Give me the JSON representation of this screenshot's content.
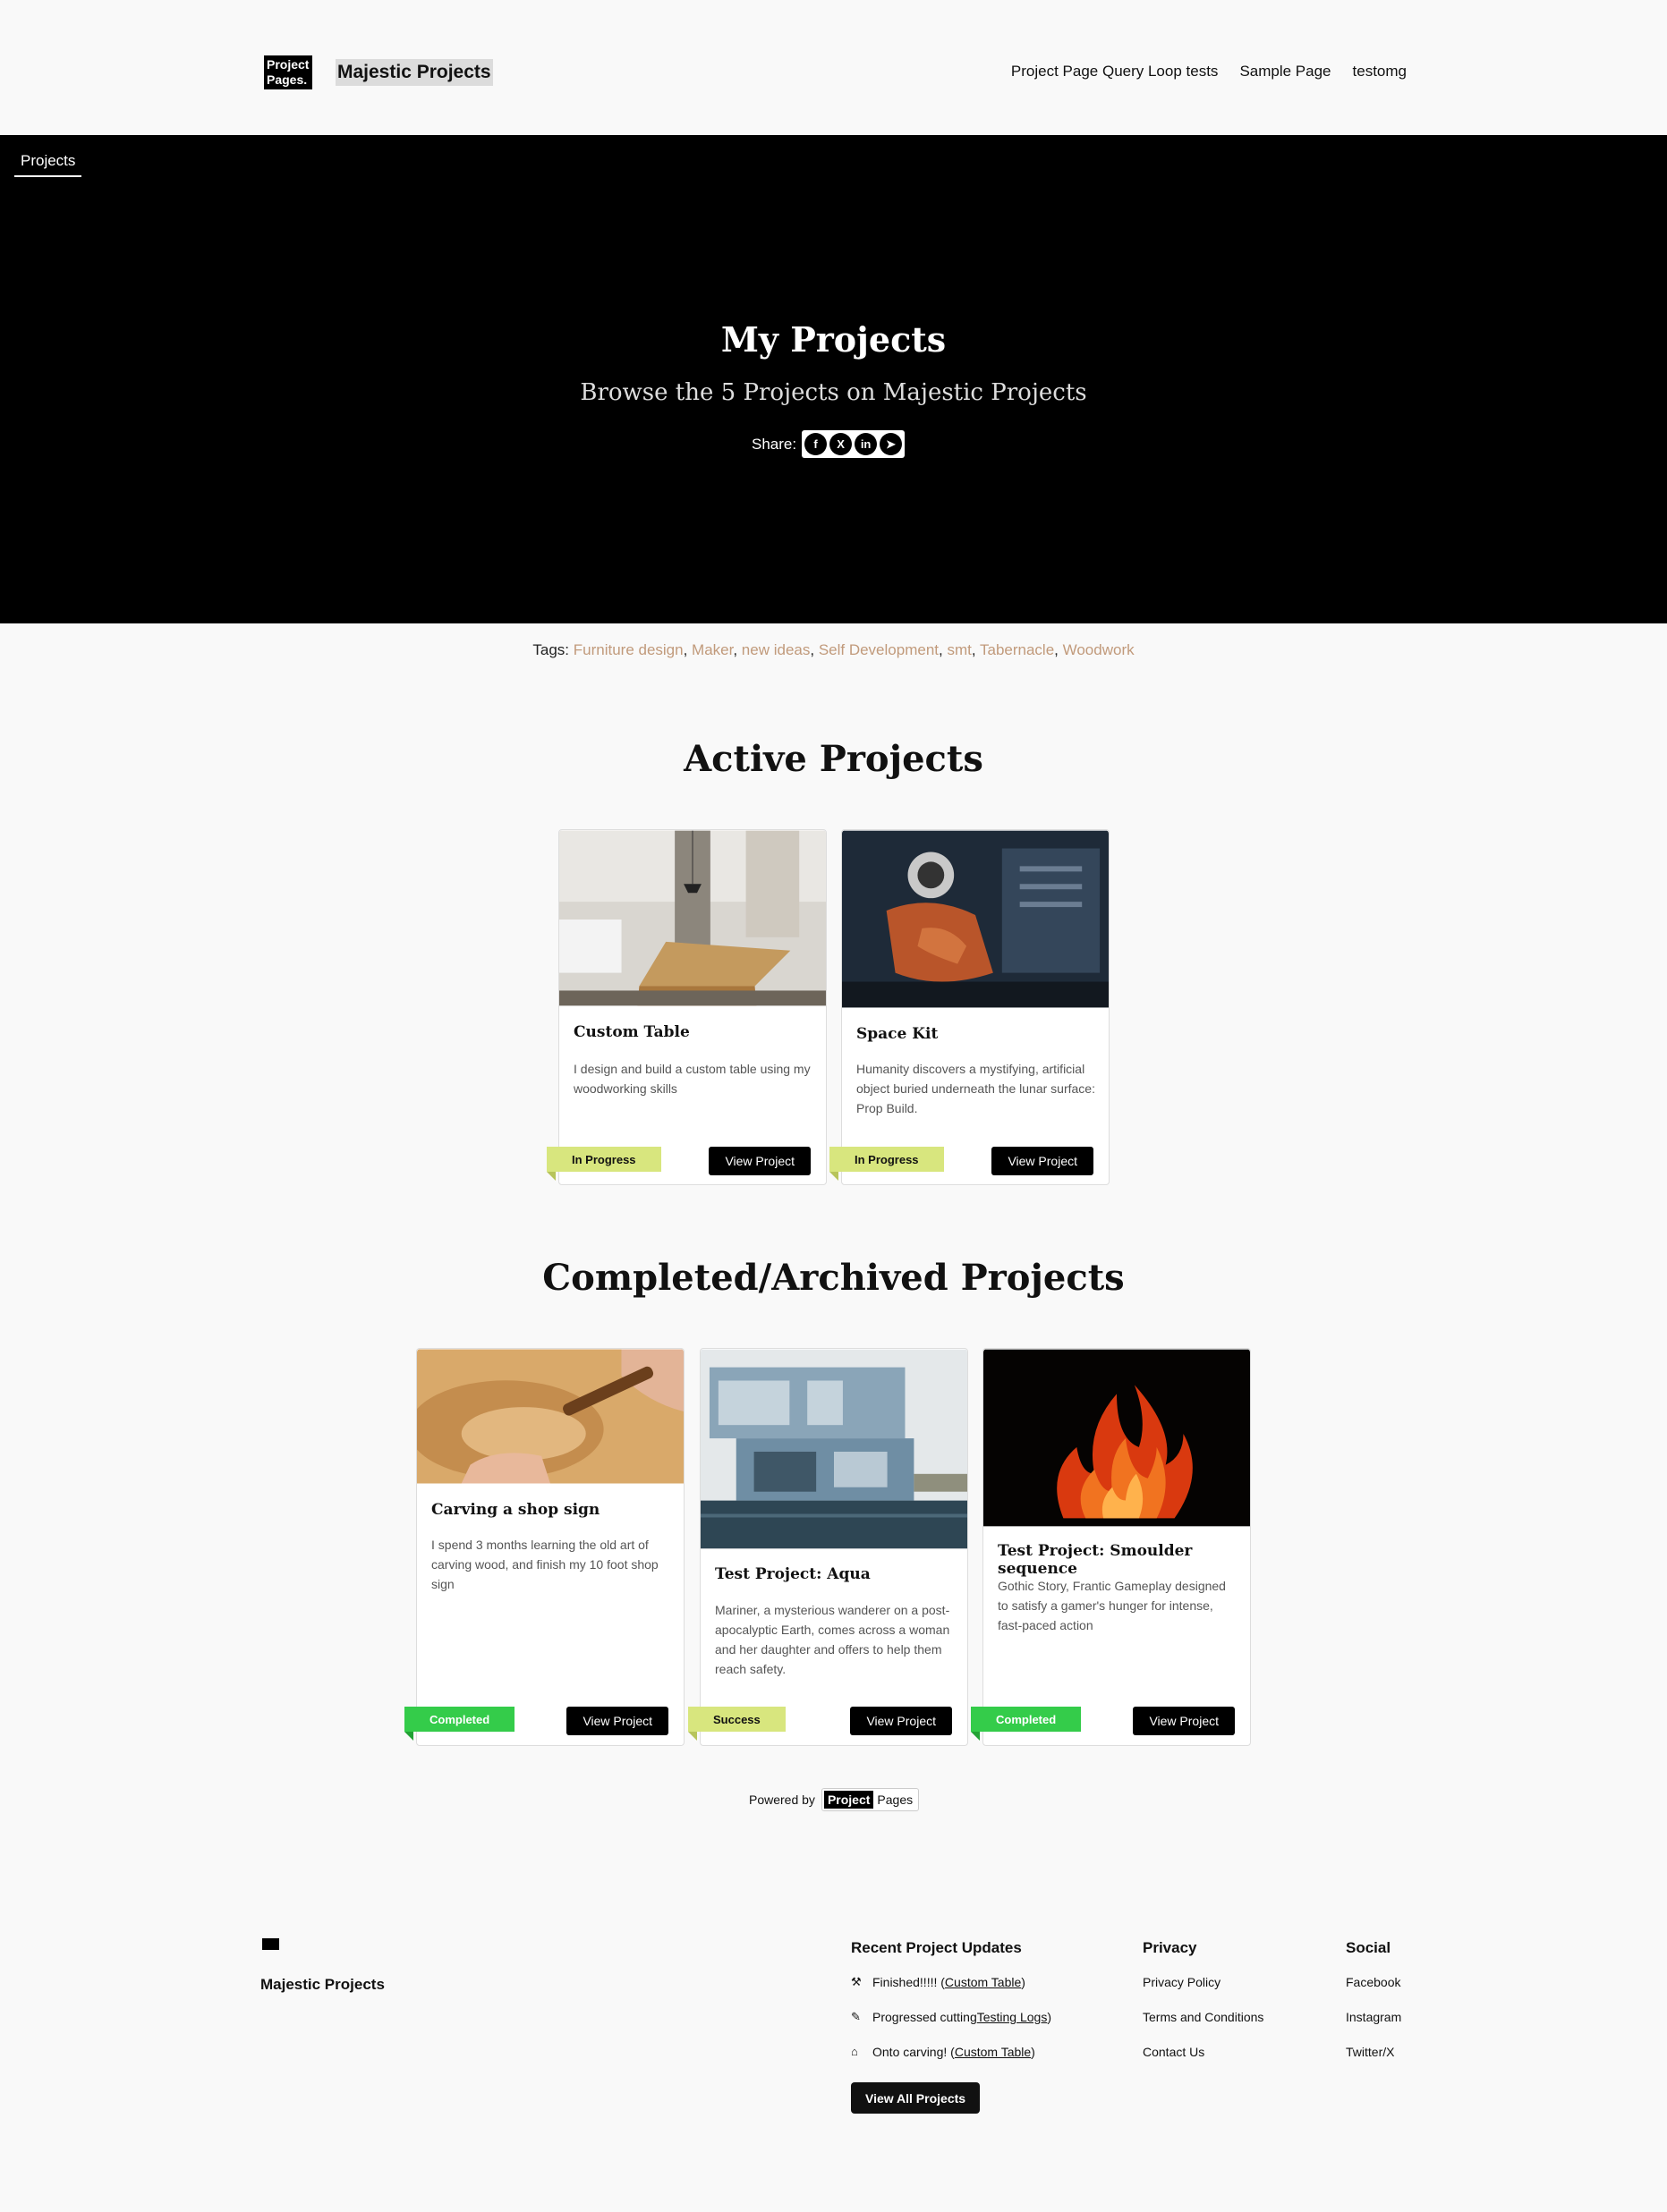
{
  "header": {
    "logo_line1": "Project",
    "logo_line2": "Pages.",
    "site_title": "Majestic Projects",
    "nav": [
      "Project Page Query Loop tests",
      "Sample Page",
      "testomg"
    ]
  },
  "hero": {
    "breadcrumb": "Projects",
    "title": "My Projects",
    "subtitle": "Browse the 5 Projects on Majestic Projects",
    "share_label": "Share:",
    "share_icons": [
      "facebook-icon",
      "x-icon",
      "linkedin-icon",
      "telegram-icon"
    ]
  },
  "tags": {
    "label": "Tags:",
    "items": [
      "Furniture design",
      "Maker",
      "new ideas",
      "Self Development",
      "smt",
      "Tabernacle",
      "Woodwork"
    ]
  },
  "active": {
    "title": "Active Projects",
    "cards": [
      {
        "title": "Custom Table",
        "desc": "I design and build a custom table using my woodworking skills",
        "status": "In Progress",
        "button": "View Project"
      },
      {
        "title": "Space Kit",
        "desc": "Humanity discovers a mystifying, artificial object buried underneath the lunar surface: Prop Build.",
        "status": "In Progress",
        "button": "View Project"
      }
    ]
  },
  "completed": {
    "title": "Completed/Archived Projects",
    "cards": [
      {
        "title": "Carving a shop sign",
        "desc": "I spend 3 months learning the old art of carving wood, and finish my 10 foot shop sign",
        "status": "Completed",
        "button": "View Project"
      },
      {
        "title": "Test Project: Aqua",
        "desc": "Mariner, a mysterious wanderer on a post-apocalyptic Earth, comes across a woman and her daughter and offers to help them reach safety.",
        "status": "Success",
        "button": "View Project"
      },
      {
        "title": "Test Project: Smoulder sequence",
        "desc": "Gothic Story, Frantic Gameplay designed to satisfy a gamer's hunger for intense, fast-paced action",
        "status": "Completed",
        "button": "View Project"
      }
    ]
  },
  "powered": {
    "label": "Powered by",
    "brand_bold": "Project",
    "brand_rest": "Pages"
  },
  "footer": {
    "site_title": "Majestic Projects",
    "updates": {
      "title": "Recent Project Updates",
      "items": [
        {
          "text": "Finished!!!!! (",
          "link": "Custom Table",
          "end": ")"
        },
        {
          "text": "Progressed cutting",
          "link": "Testing Logs",
          "end": ")"
        },
        {
          "text": "Onto carving! (",
          "link": "Custom Table",
          "end": ")"
        }
      ],
      "button": "View All Projects"
    },
    "privacy": {
      "title": "Privacy",
      "items": [
        "Privacy Policy",
        "Terms and Conditions",
        "Contact Us"
      ]
    },
    "social": {
      "title": "Social",
      "items": [
        "Facebook",
        "Instagram",
        "Twitter/X"
      ]
    }
  }
}
